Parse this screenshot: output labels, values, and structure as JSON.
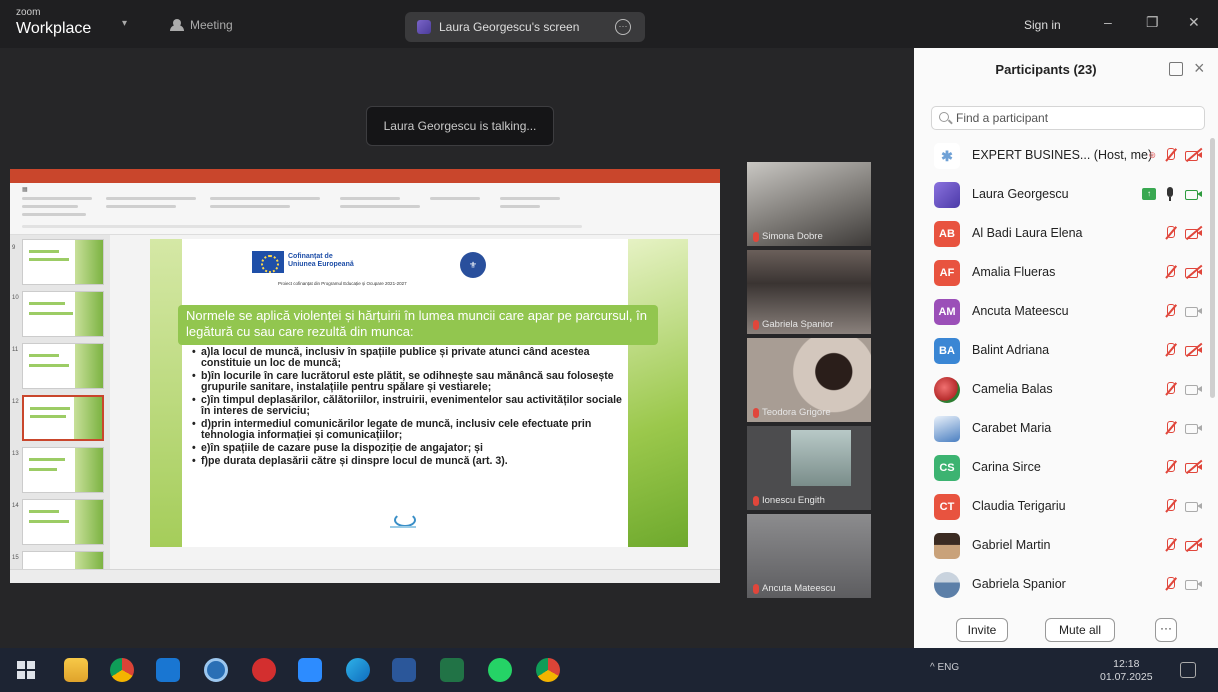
{
  "titlebar": {
    "brand_top": "zoom",
    "brand_main": "Workplace",
    "meeting_label": "Meeting",
    "screen_tab_label": "Laura Georgescu's screen",
    "sign_in": "Sign in",
    "minimize": "–",
    "restore": "❐",
    "close": "✕"
  },
  "stage": {
    "talking_toast": "Laura Georgescu is talking..."
  },
  "slide": {
    "eu_line1": "Cofinanțat de",
    "eu_line2": "Uniunea Europeană",
    "program_line": "Proiect cofinanțat din Programul Educație și Ocupare 2021-2027",
    "heading": "Normele se aplică violenței și hărțuirii în lumea muncii care apar pe parcursul, în legătură cu sau care rezultă din munca:",
    "bullets": [
      "a)la locul de muncă, inclusiv în spațiile publice și private atunci când acestea constituie un loc de muncă;",
      "b)în locurile în care lucrătorul este plătit, se odihnește sau mănâncă sau folosește grupurile sanitare, instalațiile pentru spălare și vestiarele;",
      "c)în timpul deplasărilor, călătoriilor, instruirii, evenimentelor sau activităților sociale în interes de serviciu;",
      "d)prin intermediul comunicărilor legate de muncă, inclusiv cele efectuate prin tehnologia informației și comunicațiilor;",
      "e)în spațiile de cazare puse la dispoziție de angajator; și",
      "f)pe durata deplasării către și dinspre locul de muncă (art. 3)."
    ]
  },
  "videos": [
    {
      "name": "Simona Dobre"
    },
    {
      "name": "Gabriela Spanior"
    },
    {
      "name": "Teodora Grigore"
    },
    {
      "name": "Ionescu Engith"
    },
    {
      "name": "Ancuta Mateescu"
    }
  ],
  "participants": {
    "title": "Participants (23)",
    "search_placeholder": "Find a participant",
    "list": [
      {
        "initials": "",
        "name": "EXPERT BUSINES... (Host, me)",
        "color": "#ffffff",
        "mic": "off",
        "cam": "off"
      },
      {
        "initials": "",
        "name": "Laura Georgescu",
        "color": "#6b5bd6",
        "mic": "on",
        "cam": "on"
      },
      {
        "initials": "AB",
        "name": "Al Badi Laura Elena",
        "color": "#e8533f",
        "mic": "off",
        "cam": "off"
      },
      {
        "initials": "AF",
        "name": "Amalia Flueras",
        "color": "#e8533f",
        "mic": "off",
        "cam": "off"
      },
      {
        "initials": "AM",
        "name": "Ancuta Mateescu",
        "color": "#9b4fb8",
        "mic": "off",
        "cam": "idle"
      },
      {
        "initials": "BA",
        "name": "Balint Adriana",
        "color": "#3a86d4",
        "mic": "off",
        "cam": "off"
      },
      {
        "initials": "",
        "name": "Camelia Balas",
        "color": "#d9534f",
        "mic": "off",
        "cam": "idle"
      },
      {
        "initials": "",
        "name": "Carabet Maria",
        "color": "#4a7fc1",
        "mic": "off",
        "cam": "idle"
      },
      {
        "initials": "CS",
        "name": "Carina Sirce",
        "color": "#3cb371",
        "mic": "off",
        "cam": "off"
      },
      {
        "initials": "CT",
        "name": "Claudia Terigariu",
        "color": "#e8533f",
        "mic": "off",
        "cam": "idle"
      },
      {
        "initials": "",
        "name": "Gabriel Martin",
        "color": "#c9a27a",
        "mic": "off",
        "cam": "off"
      },
      {
        "initials": "",
        "name": "Gabriela Spanior",
        "color": "#5c7fa8",
        "mic": "off",
        "cam": "idle"
      }
    ],
    "invite": "Invite",
    "mute_all": "Mute all",
    "more": "···"
  },
  "taskbar": {
    "tray_text": "^  ENG",
    "time": "12:18",
    "date": "01.07.2025"
  }
}
